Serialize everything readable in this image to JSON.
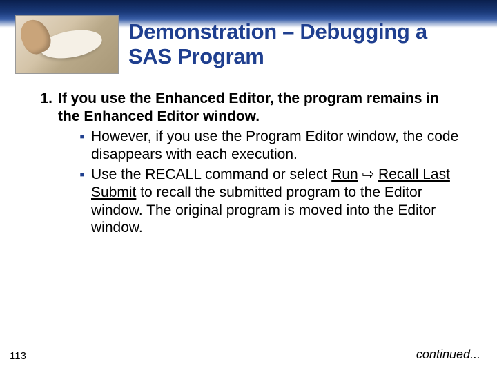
{
  "title": "Demonstration – Debugging a SAS Program",
  "list": {
    "num": "1.",
    "text": "If you use the Enhanced Editor, the program remains in the Enhanced Editor window.",
    "subs": [
      {
        "bullet": "■",
        "html": "However, if you use the Program Editor window, the code disappears with each execution."
      },
      {
        "bullet": "■",
        "html": "Use the RECALL command or select <span class=\"u\">Run</span> <span class=\"arrow\">⇨</span> <span class=\"u\">Recall Last Submit</span> to recall the submitted program to the Editor window. The original program is moved into the Editor window."
      }
    ]
  },
  "page": "113",
  "continued": "continued..."
}
